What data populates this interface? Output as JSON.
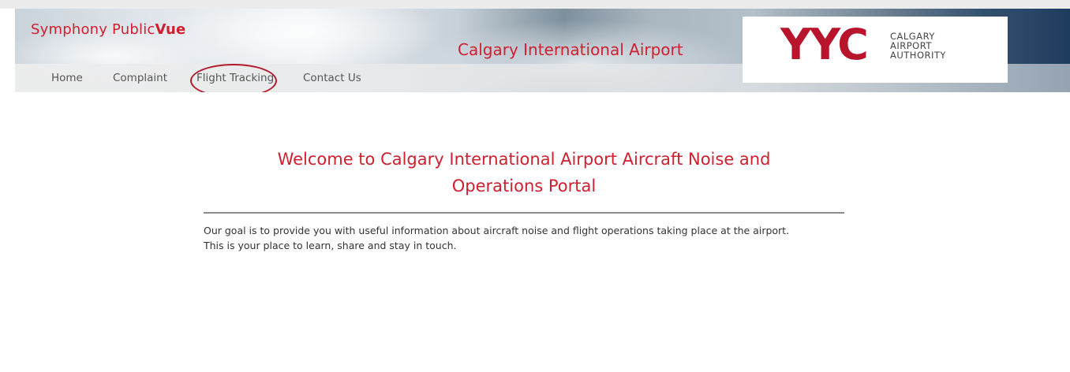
{
  "header": {
    "brand_prefix": "Symphony Public",
    "brand_suffix": "Vue",
    "site_title": "Calgary International Airport",
    "logo": {
      "mark": "YYC",
      "line1": "CALGARY",
      "line2": "AIRPORT",
      "line3": "AUTHORITY"
    }
  },
  "nav": {
    "items": [
      {
        "label": "Home"
      },
      {
        "label": "Complaint"
      },
      {
        "label": "Flight Tracking"
      },
      {
        "label": "Contact Us"
      }
    ]
  },
  "main": {
    "heading_line1": "Welcome to Calgary International Airport Aircraft Noise and",
    "heading_line2": "Operations Portal",
    "intro_line1": "Our goal is to provide you with useful information about aircraft noise and flight operations taking place at the airport.",
    "intro_line2": "This is your place to learn, share and stay in touch."
  },
  "colors": {
    "brand_red": "#d01f2f",
    "logo_red": "#b8142c",
    "annotation_circle": "#b21c2b"
  }
}
